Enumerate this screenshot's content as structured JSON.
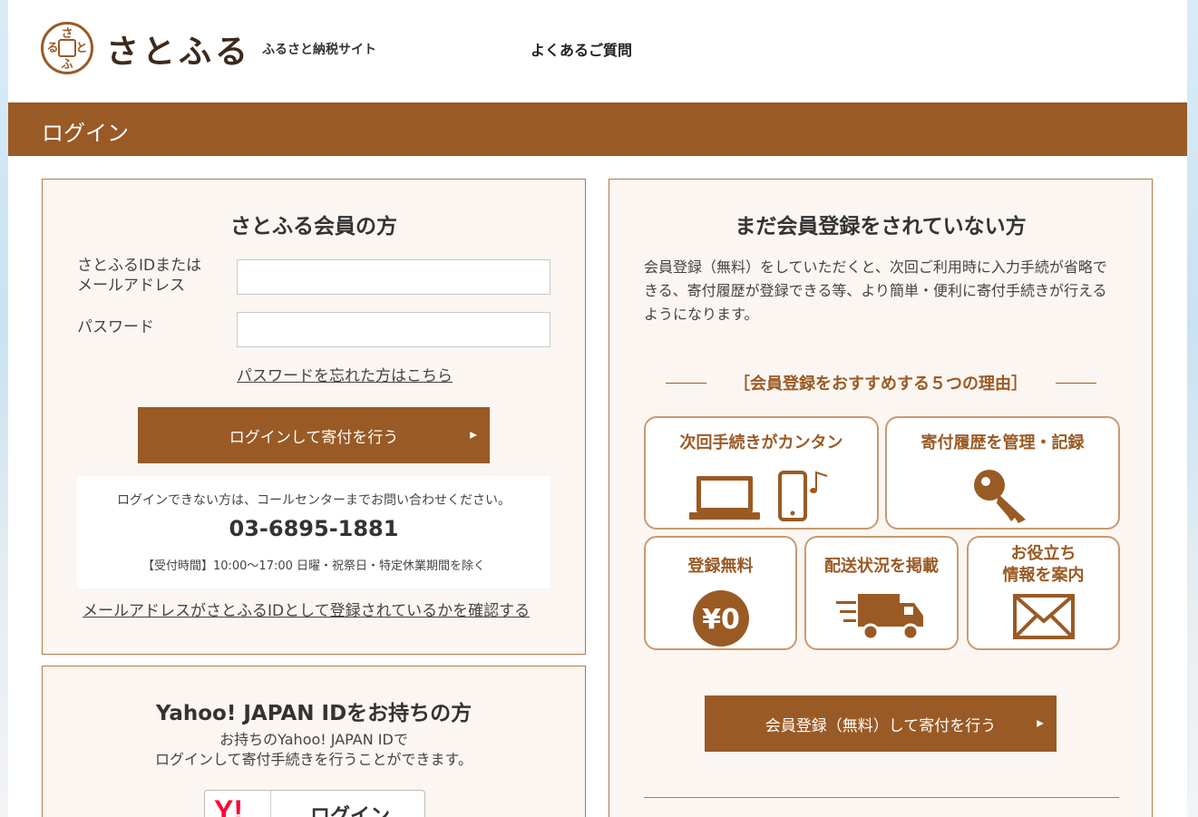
{
  "header": {
    "logo_mark": "さとふる",
    "logo_text": "さとふる",
    "logo_sub": "ふるさと納税サイト",
    "nav_faq": "よくあるご質問"
  },
  "page_title": "ログイン",
  "member": {
    "heading": "さとふる会員の方",
    "id_label": "さとふるIDまたは\nメールアドレス",
    "id_value": "",
    "password_label": "パスワード",
    "password_value": "",
    "forgot_link": "パスワードを忘れた方はこちら",
    "login_button": "ログインして寄付を行う",
    "call_note": "ログインできない方は、コールセンターまでお問い合わせください。",
    "call_phone": "03-6895-1881",
    "call_hours": "【受付時間】10:00〜17:00 日曜・祝祭日・特定休業期間を除く",
    "check_link": "メールアドレスがさとふるIDとして登録されているかを確認する"
  },
  "yahoo": {
    "heading": "Yahoo! JAPAN IDをお持ちの方",
    "sub_line1": "お持ちのYahoo! JAPAN IDで",
    "sub_line2": "ログインして寄付手続きを行うことができます。",
    "logo": "Y!",
    "button_label": "ログイン"
  },
  "register": {
    "heading": "まだ会員登録をされていない方",
    "description": "会員登録（無料）をしていただくと、次回ご利用時に入力手続が省略できる、寄付履歴が登録できる等、より簡単・便利に寄付手続きが行えるようになります。",
    "reasons_heading": "［会員登録をおすすめする５つの理由］",
    "reasons": [
      {
        "title": "次回手続きがカンタン",
        "icon": "laptop-phone-icon"
      },
      {
        "title": "寄付履歴を管理・記録",
        "icon": "key-icon"
      },
      {
        "title": "登録無料",
        "icon": "yen-zero-icon",
        "icon_text": "¥0"
      },
      {
        "title": "配送状況を掲載",
        "icon": "truck-icon"
      },
      {
        "title": "お役立ち\n情報を案内",
        "icon": "envelope-icon"
      }
    ],
    "register_button": "会員登録（無料）して寄付を行う"
  },
  "colors": {
    "brand_brown": "#995a25",
    "panel_bg": "#fbf6f1",
    "card_border": "#c89a72"
  }
}
